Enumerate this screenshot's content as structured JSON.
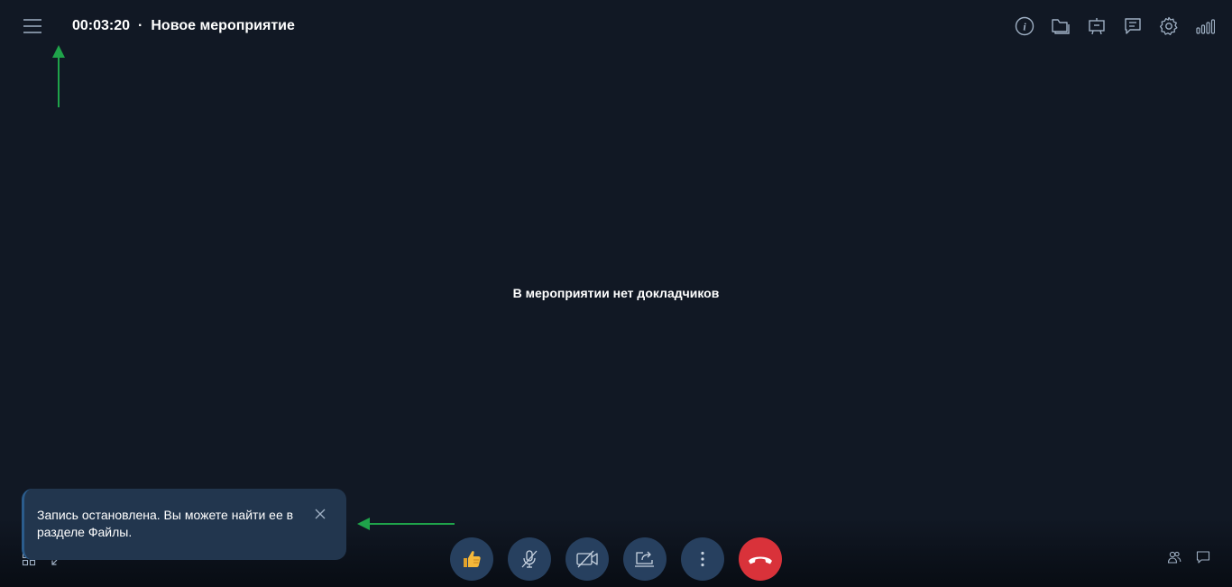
{
  "header": {
    "timer": "00:03:20",
    "separator": "·",
    "event_title": "Новое мероприятие"
  },
  "top_icons": [
    "info-icon",
    "folder-icon",
    "presentation-icon",
    "chat-list-icon",
    "gear-icon",
    "signal-icon"
  ],
  "main": {
    "empty_message": "В мероприятии нет докладчиков"
  },
  "toast": {
    "message": "Запись остановлена. Вы можете найти ее в разделе Файлы."
  },
  "controls": [
    "thumbs-up-icon",
    "mic-off-icon",
    "camera-off-icon",
    "share-screen-icon",
    "more-icon",
    "hangup-icon"
  ],
  "colors": {
    "background": "#111824",
    "control_bg": "#27405f",
    "hangup": "#d9323a",
    "toast_bg": "#22364e",
    "annotation_arrow": "#1fa34a"
  }
}
